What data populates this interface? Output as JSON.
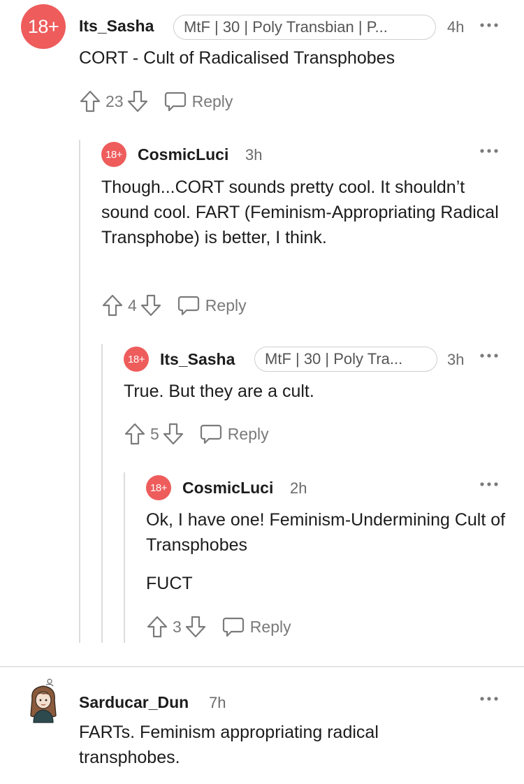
{
  "comments": [
    {
      "avatar": "18+",
      "username": "Its_Sasha",
      "flair": "MtF | 30 | Poly Transbian | P...",
      "time": "4h",
      "body": [
        "CORT - Cult of Radicalised Transphobes"
      ],
      "votes": "23",
      "reply_label": "Reply"
    },
    {
      "avatar": "18+",
      "username": "CosmicLuci",
      "time": "3h",
      "body": [
        "Though...CORT sounds pretty cool. It shouldn’t sound cool. FART (Feminism-Appropriating Radical Transphobe) is better, I think."
      ],
      "votes": "4",
      "reply_label": "Reply"
    },
    {
      "avatar": "18+",
      "username": "Its_Sasha",
      "flair": "MtF | 30 | Poly Tra...",
      "time": "3h",
      "body": [
        "True. But they are a cult."
      ],
      "votes": "5",
      "reply_label": "Reply"
    },
    {
      "avatar": "18+",
      "username": "CosmicLuci",
      "time": "2h",
      "body": [
        "Ok, I have one! Feminism-Undermining Cult of Transphobes",
        "FUCT"
      ],
      "votes": "3",
      "reply_label": "Reply"
    },
    {
      "avatar_icon": "user-avatar-illustration",
      "username": "Sarducar_Dun",
      "time": "7h",
      "body": [
        "FARTs. Feminism appropriating radical transphobes."
      ]
    }
  ],
  "icons": {
    "upvote": "upvote-arrow-icon",
    "downvote": "downvote-arrow-icon",
    "reply": "speech-bubble-icon",
    "more": "more-options-icon"
  },
  "colors": {
    "avatar_bg": "#ee5c5c",
    "muted": "#7a7a7a",
    "rail": "#dcdcdc"
  }
}
